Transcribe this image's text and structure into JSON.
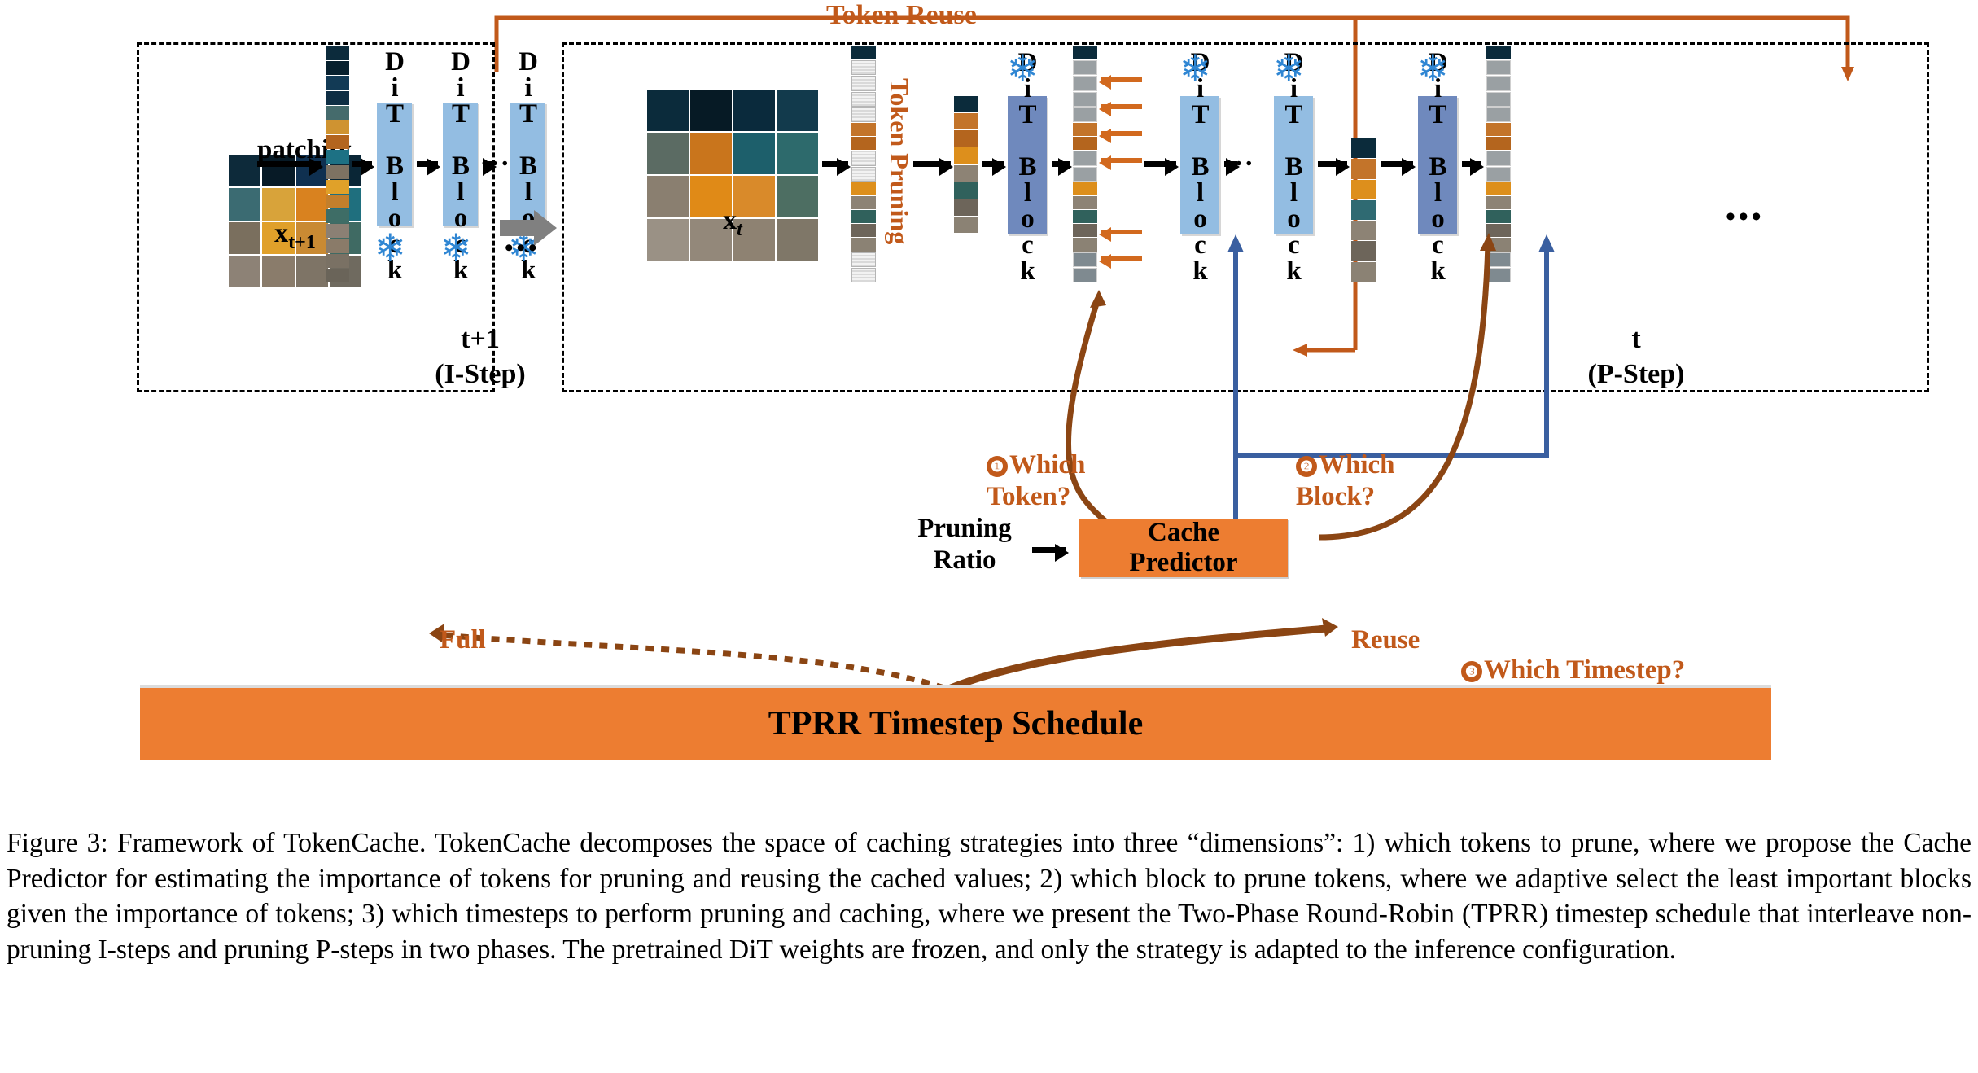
{
  "figure": {
    "number": "Figure 3:",
    "caption": "Figure 3: Framework of TokenCache. TokenCache decomposes the space of caching strategies into three “dimensions”: 1) which tokens to prune, where we propose the Cache Predictor for estimating the importance of tokens for pruning and reusing the cached values; 2) which block to prune tokens, where we adaptive select the least important blocks given the importance of tokens; 3) which timesteps to perform pruning and caching, where we present the Two-Phase Round-Robin (TPRR) timestep schedule that interleave non-pruning I-steps and pruning P-steps in two phases. The pretrained DiT weights are frozen, and only the strategy is adapted to the inference configuration."
  },
  "diagram": {
    "top_label": "Token Reuse",
    "left_panel": {
      "input_label": "x",
      "input_sub": "t+1",
      "patchify_label": "patchify",
      "blocks": [
        "DiT Block",
        "DiT Block",
        "DiT Block"
      ],
      "ellipsis": "...",
      "step_label_line1": "t+1",
      "step_label_line2": "(I-Step)",
      "frozen_icon": "❄"
    },
    "between_panels": {
      "ellipsis": "•••"
    },
    "right_panel": {
      "input_label": "x",
      "input_sub": "t",
      "token_pruning_label": "Token Pruning",
      "blocks": [
        "DiT Block",
        "DiT Block",
        "DiT Block",
        "DiT Block"
      ],
      "ellipsis": "...",
      "step_label_line1": "t",
      "step_label_line2": "(P-Step)",
      "frozen_icon": "❄",
      "trailing_ellipsis": "•••"
    },
    "predictor": {
      "input_label_line1": "Pruning",
      "input_label_line2": "Ratio",
      "box_line1": "Cache",
      "box_line2": "Predictor"
    },
    "questions": {
      "q1_num": "❶",
      "q1_line1": "Which",
      "q1_line2": "Token?",
      "q2_num": "❷",
      "q2_line1": "Which",
      "q2_line2": "Block?",
      "q3_num": "❸",
      "q3_text": "Which Timestep?"
    },
    "bottom": {
      "full_label": "Full",
      "reuse_label": "Reuse",
      "schedule_label": "TPRR Timestep Schedule"
    },
    "colors": {
      "accent_orange": "#ed7d31",
      "dark_orange_text": "#c1591a",
      "block_light": "#93bde2",
      "block_dark": "#6f89bd",
      "snowflake_blue": "#2f86d3",
      "arrow_blue": "#3a5fa0",
      "arrow_brown": "#8b4513"
    }
  }
}
